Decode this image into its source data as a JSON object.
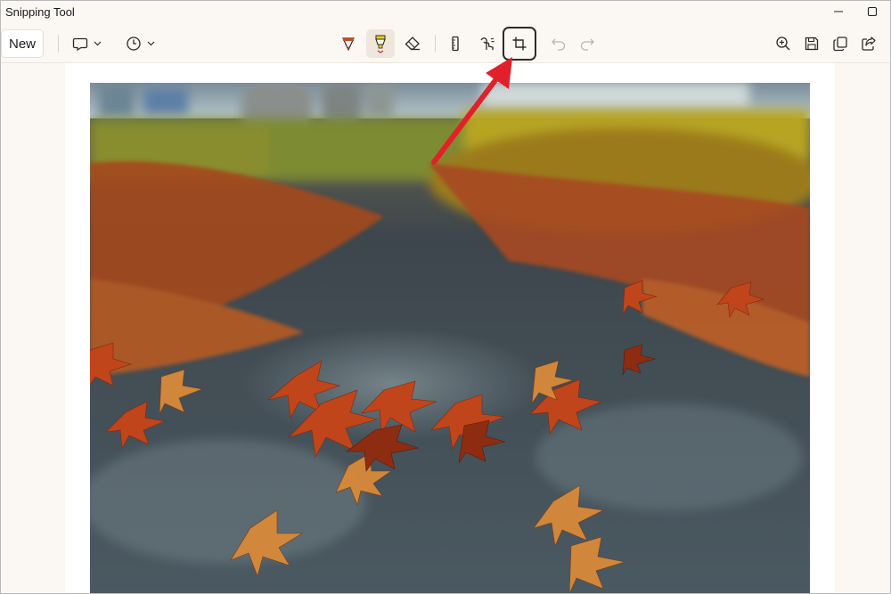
{
  "window": {
    "title": "Snipping Tool"
  },
  "toolbar": {
    "new_label": "New",
    "snip_mode_icon": "rectangle-snip-icon",
    "delay_icon": "clock-icon",
    "tools": [
      "ballpoint-pen-icon",
      "highlighter-icon",
      "eraser-icon",
      "ruler-icon",
      "touch-writing-icon",
      "crop-icon",
      "undo-icon",
      "redo-icon"
    ],
    "actions": [
      "zoom-in-icon",
      "save-icon",
      "copy-icon",
      "share-icon"
    ],
    "active_tool": "highlighter",
    "highlighted_tool": "crop"
  },
  "colors": {
    "pen": "#c84a1e",
    "highlighter": "#f2d20a",
    "annotation_arrow": "#e2202a",
    "window_bg": "#fbf7f3"
  }
}
